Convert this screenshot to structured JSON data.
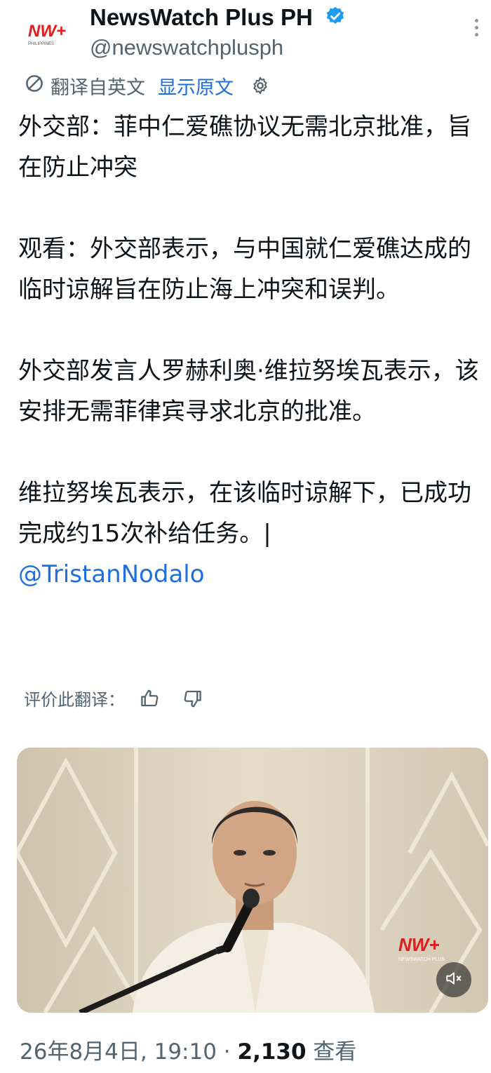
{
  "account": {
    "name": "NewsWatch Plus PH",
    "handle": "@newswatchplusph",
    "avatar_text": "NW+",
    "avatar_sub": "PHILIPPINES"
  },
  "translation": {
    "translated_from": "翻译自英文",
    "show_original": "显示原文",
    "rate_label": "评价此翻译："
  },
  "post": {
    "p1": "外交部：菲中仁爱礁协议无需北京批准，旨在防止冲突",
    "p2": "观看：外交部表示，与中国就仁爱礁达成的临时谅解旨在防止海上冲突和误判。",
    "p3": "外交部发言人罗赫利奥·维拉努埃瓦表示，该安排无需菲律宾寻求北京的批准。",
    "p4": "维拉努埃瓦表示，在该临时谅解下，已成功完成约15次补给任务。|",
    "mention": "@TristanNodalo"
  },
  "video": {
    "watermark_text": "NW+",
    "watermark_sub": "NEWSWATCH PLUS"
  },
  "meta": {
    "date": "26年8月4日, 19:10",
    "separator": " · ",
    "views_count": "2,130",
    "views_label": " 查看"
  },
  "colors": {
    "accent": "#1d6fe0",
    "muted": "#536471",
    "text": "#0f1419",
    "brand_red": "#e11d1d"
  },
  "icons": {
    "verified": "verified-badge-icon",
    "translate": "translate-icon",
    "settings": "gear-icon",
    "thumbs_up": "thumbs-up-icon",
    "thumbs_down": "thumbs-down-icon",
    "more": "more-vertical-icon",
    "mute": "speaker-muted-icon"
  }
}
